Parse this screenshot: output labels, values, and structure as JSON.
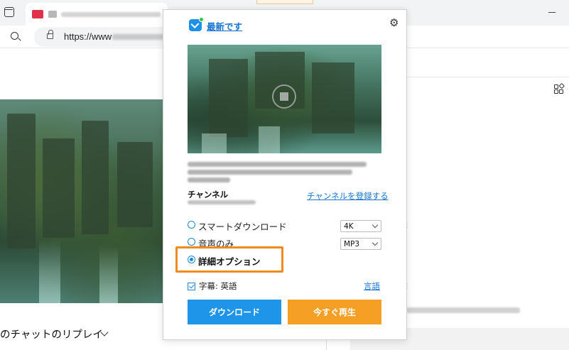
{
  "browser": {
    "url_prefix": "https://www"
  },
  "page": {
    "chat_replay_label": "のチャットのリプレイ"
  },
  "popup": {
    "update_status": "最新です",
    "channel_label": "チャンネル",
    "subscribe_link": "チャンネルを登録する",
    "options": [
      {
        "label": "スマートダウンロード",
        "selected": false,
        "select_value": "4K"
      },
      {
        "label": "音声のみ",
        "selected": false,
        "select_value": "MP3"
      },
      {
        "label": "詳細オプション",
        "selected": true
      }
    ],
    "subtitle_checkbox": {
      "label": "字幕: 英語",
      "checked": true
    },
    "language_link": "言語",
    "download_button": "ダウンロード",
    "play_now_button": "今すぐ再生",
    "colors": {
      "accent_blue": "#1e95e8",
      "accent_orange": "#f5a024",
      "highlight_orange": "#ef8a1e",
      "link_blue": "#1874d2"
    },
    "icons": [
      "app-logo-icon",
      "gear-icon"
    ]
  }
}
